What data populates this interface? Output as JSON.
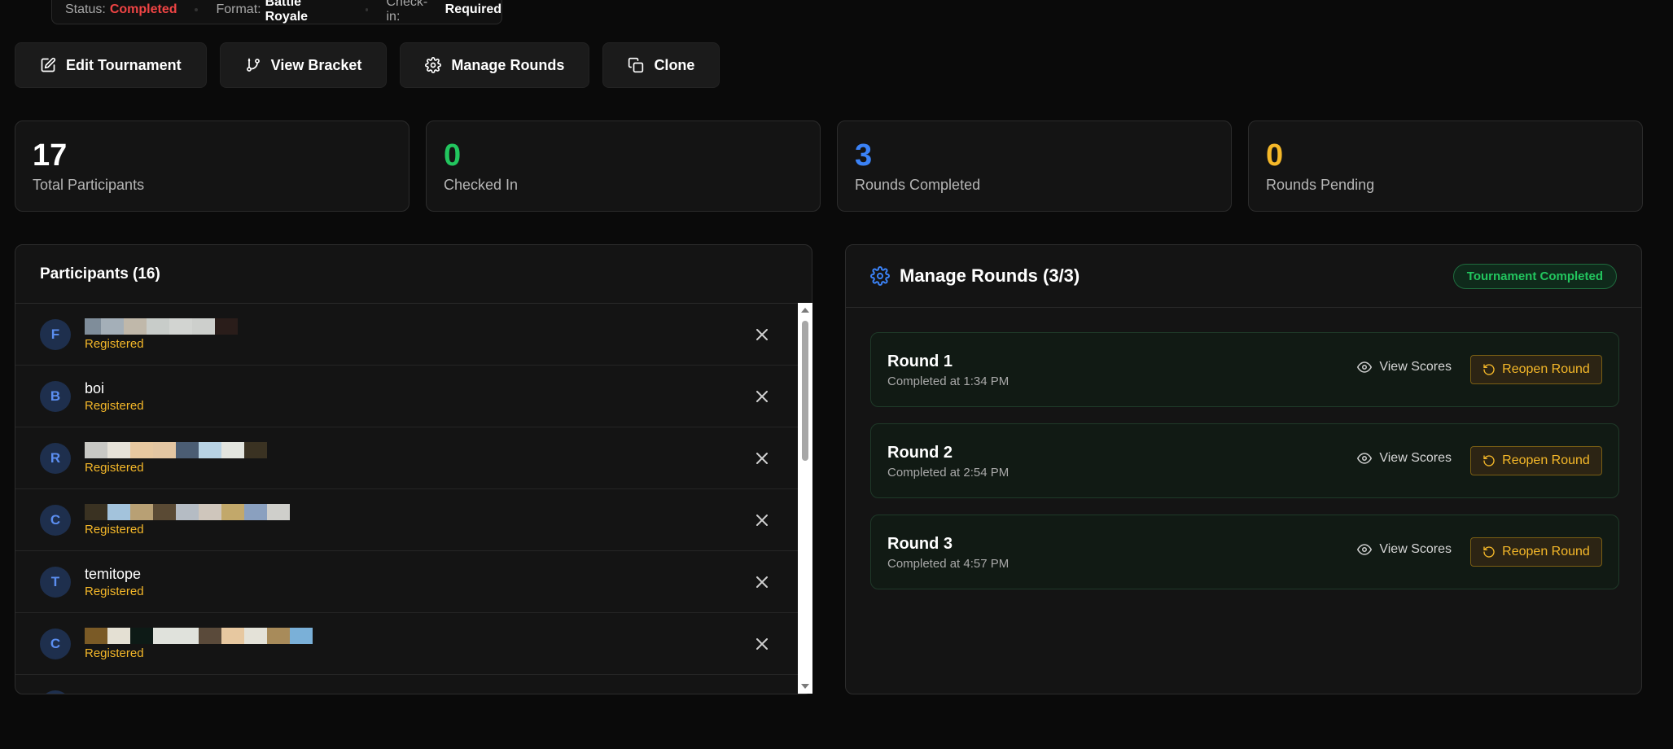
{
  "status_bar": {
    "status_label": "Status:",
    "status_value": "Completed",
    "format_label": "Format:",
    "format_value": "Battle Royale",
    "checkin_label": "Check-in:",
    "checkin_value": "Required"
  },
  "actions": {
    "edit": "Edit Tournament",
    "bracket": "View Bracket",
    "rounds": "Manage Rounds",
    "clone": "Clone"
  },
  "stats": [
    {
      "value": "17",
      "label": "Total Participants",
      "color": "#ffffff"
    },
    {
      "value": "0",
      "label": "Checked In",
      "color": "#22c55e"
    },
    {
      "value": "3",
      "label": "Rounds Completed",
      "color": "#3b82f6"
    },
    {
      "value": "0",
      "label": "Rounds Pending",
      "color": "#f5b829"
    }
  ],
  "participants": {
    "title": "Participants (16)",
    "items": [
      {
        "initial": "F",
        "name": "",
        "status": "Registered",
        "redacted": true
      },
      {
        "initial": "B",
        "name": "boi",
        "status": "Registered",
        "redacted": false
      },
      {
        "initial": "R",
        "name": "",
        "status": "Registered",
        "redacted": true
      },
      {
        "initial": "C",
        "name": "",
        "status": "Registered",
        "redacted": true
      },
      {
        "initial": "T",
        "name": "temitope",
        "status": "Registered",
        "redacted": false
      },
      {
        "initial": "C",
        "name": "",
        "status": "Registered",
        "redacted": true
      },
      {
        "initial": "",
        "name": "",
        "status": "",
        "redacted": false
      }
    ]
  },
  "rounds_panel": {
    "title": "Manage Rounds (3/3)",
    "badge": "Tournament Completed",
    "view_scores": "View Scores",
    "reopen": "Reopen Round",
    "rounds": [
      {
        "title": "Round 1",
        "completed": "Completed at 1:34 PM"
      },
      {
        "title": "Round 2",
        "completed": "Completed at 2:54 PM"
      },
      {
        "title": "Round 3",
        "completed": "Completed at 4:57 PM"
      }
    ]
  },
  "colors": {
    "accent_blue": "#3b82f6",
    "success": "#22c55e",
    "warning": "#f5b829",
    "danger": "#ef4444"
  }
}
